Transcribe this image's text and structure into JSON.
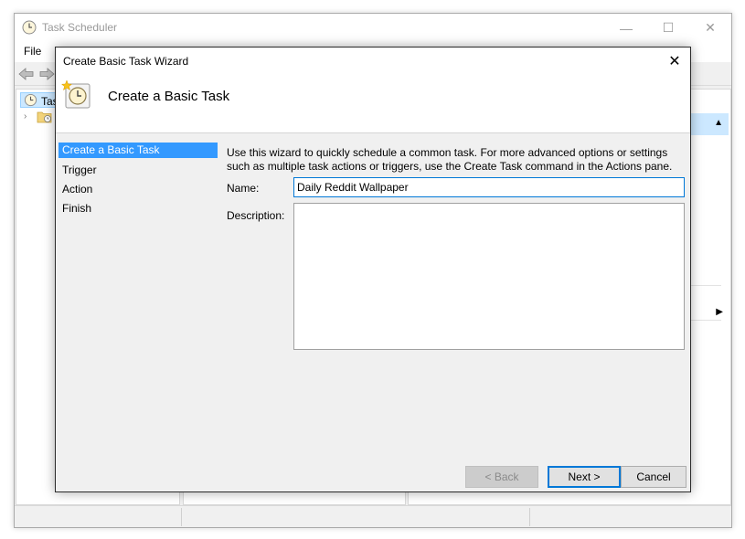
{
  "main_window": {
    "title": "Task Scheduler",
    "minimize_glyph": "—",
    "maximize_glyph": "☐",
    "close_glyph": "✕",
    "menu": {
      "file_label": "File"
    },
    "tree": {
      "root_label": "Tas"
    }
  },
  "wizard": {
    "title": "Create Basic Task Wizard",
    "close_glyph": "✕",
    "heading": "Create a Basic Task",
    "steps": [
      {
        "label": "Create a Basic Task",
        "active": true
      },
      {
        "label": "Trigger",
        "active": false
      },
      {
        "label": "Action",
        "active": false
      },
      {
        "label": "Finish",
        "active": false
      }
    ],
    "intro_text": "Use this wizard to quickly schedule a common task.  For more advanced options or settings such as multiple task actions or triggers, use the Create Task command in the Actions pane.",
    "name_label": "Name:",
    "name_value": "Daily Reddit Wallpaper",
    "description_label": "Description:",
    "description_value": "",
    "buttons": {
      "back": "< Back",
      "next": "Next >",
      "cancel": "Cancel"
    }
  },
  "icons": {
    "app": "clock-icon",
    "header": "task-clock-icon",
    "back_nav": "back-arrow-icon",
    "forward_nav": "forward-arrow-icon",
    "library": "folder-clock-icon"
  },
  "colors": {
    "selection": "#3399ff",
    "focus_border": "#0078d7",
    "tree_selection": "#cce8ff"
  }
}
